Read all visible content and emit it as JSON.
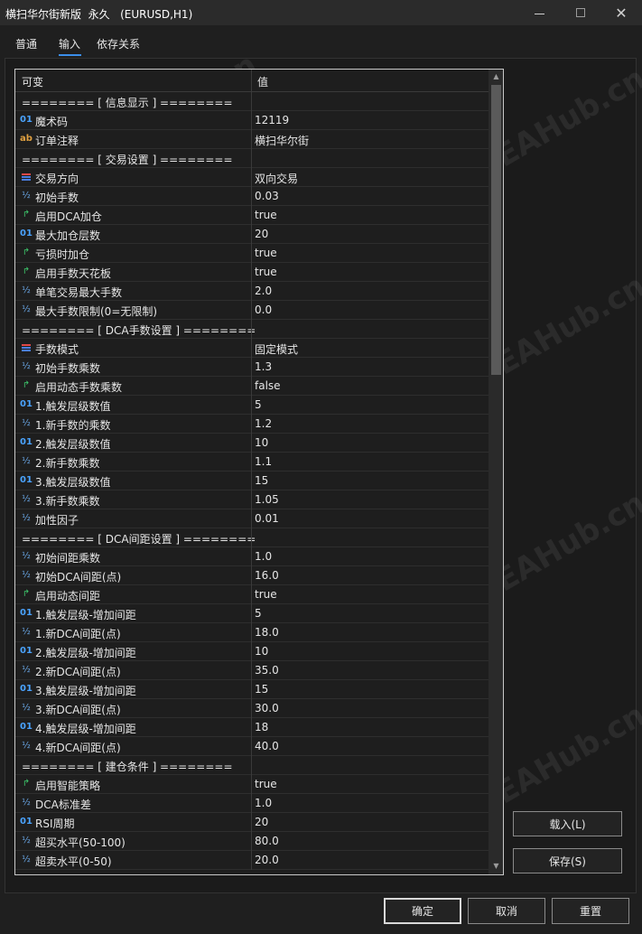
{
  "window": {
    "title": "横扫华尔街新版  永久   (EURUSD,H1)",
    "minimize": "—",
    "maximize": "□",
    "close": "✕"
  },
  "tabs": [
    {
      "label": "普通"
    },
    {
      "label": "输入"
    },
    {
      "label": "依存关系"
    }
  ],
  "table": {
    "col_name": "可变",
    "col_value": "值",
    "rows": [
      {
        "type": "section",
        "name": "======== [ 信息显示 ] ========",
        "value": ""
      },
      {
        "type": "int",
        "icon": "01",
        "name": "魔术码",
        "value": "12119"
      },
      {
        "type": "string",
        "icon": "ab",
        "name": "订单注释",
        "value": "横扫华尔街"
      },
      {
        "type": "section",
        "name": "======== [ 交易设置 ] ========",
        "value": ""
      },
      {
        "type": "enum",
        "name": "交易方向",
        "value": "双向交易"
      },
      {
        "type": "double",
        "icon": "½",
        "name": "初始手数",
        "value": "0.03"
      },
      {
        "type": "bool",
        "icon": "↱",
        "name": "启用DCA加仓",
        "value": "true"
      },
      {
        "type": "int",
        "icon": "01",
        "name": "最大加仓层数",
        "value": "20"
      },
      {
        "type": "bool",
        "icon": "↱",
        "name": "亏损时加仓",
        "value": "true"
      },
      {
        "type": "bool",
        "icon": "↱",
        "name": "启用手数天花板",
        "value": "true"
      },
      {
        "type": "double",
        "icon": "½",
        "name": "单笔交易最大手数",
        "value": "2.0"
      },
      {
        "type": "double",
        "icon": "½",
        "name": "最大手数限制(0=无限制)",
        "value": "0.0"
      },
      {
        "type": "section",
        "name": "======== [ DCA手数设置 ] ========",
        "value": ""
      },
      {
        "type": "enum",
        "name": "手数模式",
        "value": "固定模式"
      },
      {
        "type": "double",
        "icon": "½",
        "name": "初始手数乘数",
        "value": "1.3"
      },
      {
        "type": "bool",
        "icon": "↱",
        "name": "启用动态手数乘数",
        "value": "false"
      },
      {
        "type": "int",
        "icon": "01",
        "name": "1.触发层级数值",
        "value": "5"
      },
      {
        "type": "double",
        "icon": "½",
        "name": "1.新手数的乘数",
        "value": "1.2"
      },
      {
        "type": "int",
        "icon": "01",
        "name": "2.触发层级数值",
        "value": "10"
      },
      {
        "type": "double",
        "icon": "½",
        "name": "2.新手数乘数",
        "value": "1.1"
      },
      {
        "type": "int",
        "icon": "01",
        "name": "3.触发层级数值",
        "value": "15"
      },
      {
        "type": "double",
        "icon": "½",
        "name": "3.新手数乘数",
        "value": "1.05"
      },
      {
        "type": "double",
        "icon": "½",
        "name": "加性因子",
        "value": "0.01"
      },
      {
        "type": "section",
        "name": "======== [ DCA间距设置 ] ========",
        "value": ""
      },
      {
        "type": "double",
        "icon": "½",
        "name": "初始间距乘数",
        "value": "1.0"
      },
      {
        "type": "double",
        "icon": "½",
        "name": "初始DCA间距(点)",
        "value": "16.0"
      },
      {
        "type": "bool",
        "icon": "↱",
        "name": "启用动态间距",
        "value": "true"
      },
      {
        "type": "int",
        "icon": "01",
        "name": "1.触发层级-增加间距",
        "value": "5"
      },
      {
        "type": "double",
        "icon": "½",
        "name": "1.新DCA间距(点)",
        "value": "18.0"
      },
      {
        "type": "int",
        "icon": "01",
        "name": "2.触发层级-增加间距",
        "value": "10"
      },
      {
        "type": "double",
        "icon": "½",
        "name": "2.新DCA间距(点)",
        "value": "35.0"
      },
      {
        "type": "int",
        "icon": "01",
        "name": "3.触发层级-增加间距",
        "value": "15"
      },
      {
        "type": "double",
        "icon": "½",
        "name": "3.新DCA间距(点)",
        "value": "30.0"
      },
      {
        "type": "int",
        "icon": "01",
        "name": "4.触发层级-增加间距",
        "value": "18"
      },
      {
        "type": "double",
        "icon": "½",
        "name": "4.新DCA间距(点)",
        "value": "40.0"
      },
      {
        "type": "section",
        "name": "======== [ 建仓条件 ] ========",
        "value": ""
      },
      {
        "type": "bool",
        "icon": "↱",
        "name": "启用智能策略",
        "value": "true"
      },
      {
        "type": "double",
        "icon": "½",
        "name": "DCA标准差",
        "value": "1.0"
      },
      {
        "type": "int",
        "icon": "01",
        "name": "RSI周期",
        "value": "20"
      },
      {
        "type": "double",
        "icon": "½",
        "name": "超买水平(50-100)",
        "value": "80.0"
      },
      {
        "type": "double",
        "icon": "½",
        "name": "超卖水平(0-50)",
        "value": "20.0"
      }
    ]
  },
  "buttons": {
    "load": "载入(L)",
    "save": "保存(S)",
    "ok": "确定",
    "cancel": "取消",
    "reset": "重置"
  },
  "watermark": "EAHub.cn",
  "colors": {
    "accent": "#3b8eea",
    "int_icon": "#4aa3ff",
    "string_icon": "#e0a040",
    "bool_icon": "#3cc56a",
    "enum_icon_top": "#e04848",
    "enum_icon_bottom": "#4a7de0"
  }
}
